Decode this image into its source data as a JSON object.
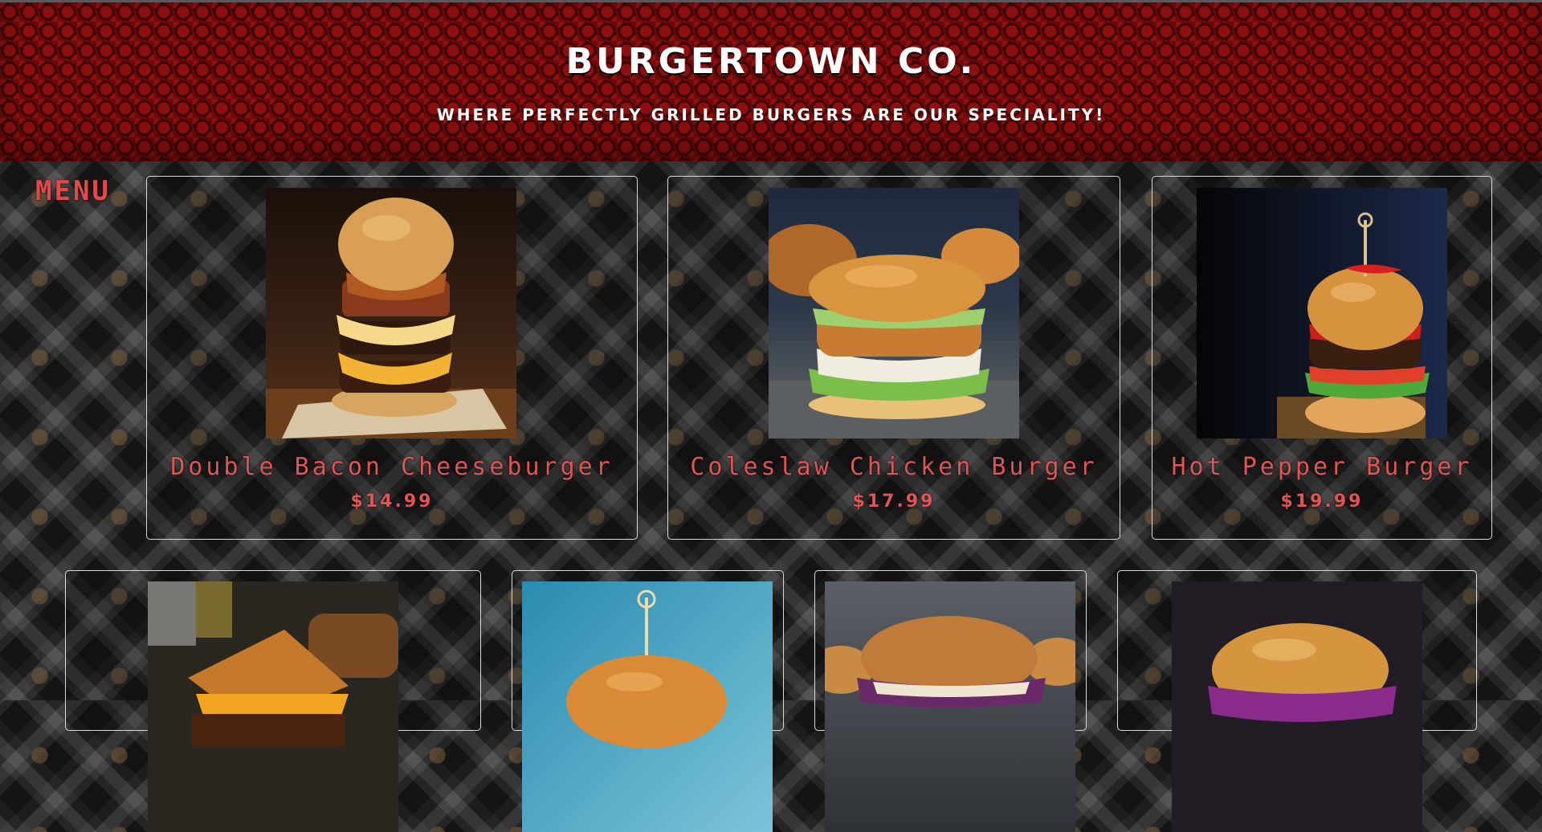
{
  "header": {
    "title": "BURGERTOWN CO.",
    "tagline": "WHERE PERFECTLY GRILLED BURGERS ARE OUR SPECIALITY!"
  },
  "menu": {
    "label": "MENU",
    "items": [
      {
        "name": "Double Bacon Cheeseburger",
        "price": "$14.99",
        "image_icon": "double-bacon-cheeseburger-photo"
      },
      {
        "name": "Coleslaw Chicken Burger",
        "price": "$17.99",
        "image_icon": "coleslaw-chicken-burger-photo"
      },
      {
        "name": "Hot Pepper Burger",
        "price": "$19.99",
        "image_icon": "hot-pepper-burger-photo"
      },
      {
        "name": "",
        "price": "",
        "image_icon": "grilled-cheese-sandwich-photo"
      },
      {
        "name": "",
        "price": "",
        "image_icon": "skewered-burger-photo"
      },
      {
        "name": "",
        "price": "",
        "image_icon": "onion-burger-photo"
      },
      {
        "name": "",
        "price": "",
        "image_icon": "red-cabbage-burger-photo"
      }
    ]
  },
  "colors": {
    "header_red": "#6e0a0a",
    "accent_red": "#e05555",
    "text_white": "#ffffff",
    "card_border": "#d9d9d9"
  }
}
